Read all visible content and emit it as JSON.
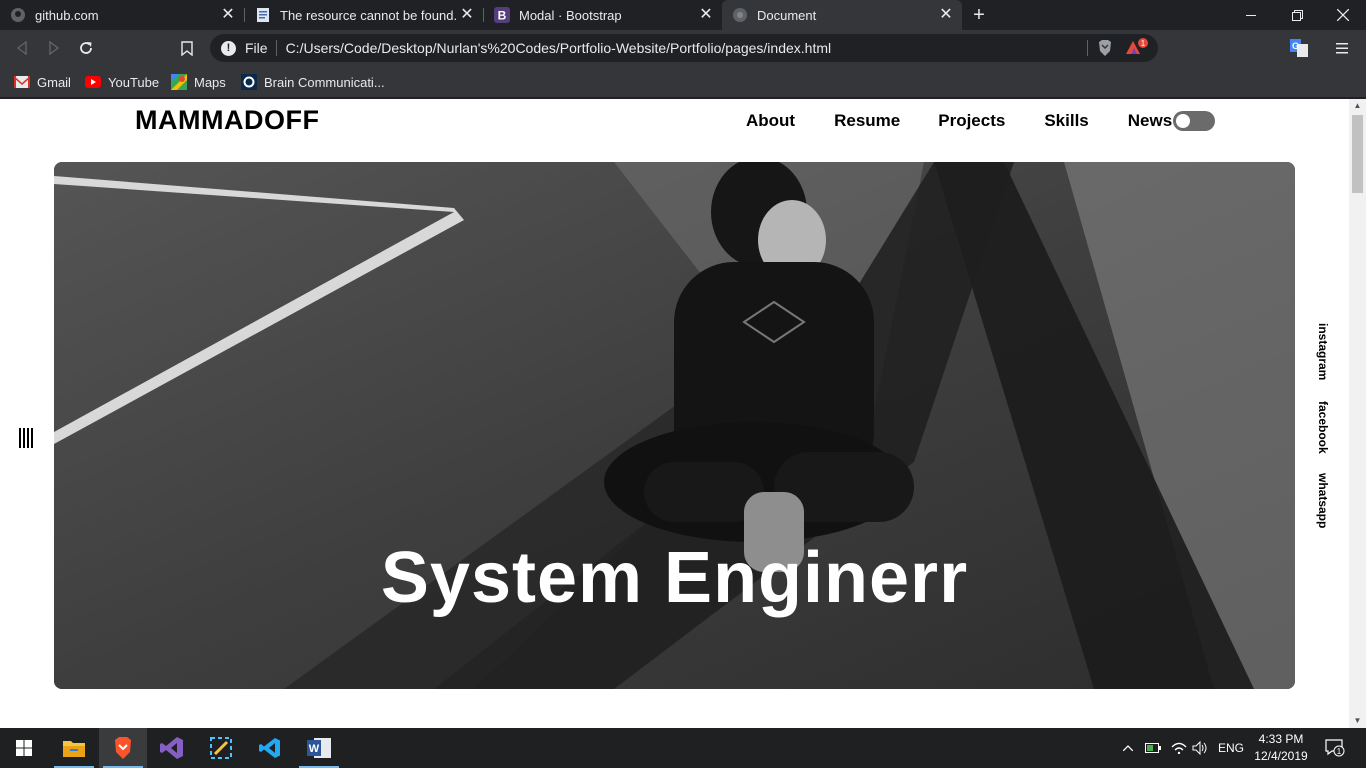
{
  "browser": {
    "tabs": [
      {
        "title": "github.com",
        "icon": "github-icon",
        "active": false
      },
      {
        "title": "The resource cannot be found.",
        "icon": "document-icon",
        "active": false
      },
      {
        "title": "Modal · Bootstrap",
        "icon": "bootstrap-icon",
        "active": false
      },
      {
        "title": "Document",
        "icon": "globe-icon",
        "active": true
      }
    ],
    "address": {
      "scheme_label": "File",
      "url": "C:/Users/Code/Desktop/Nurlan's%20Codes/Portfolio-Website/Portfolio/pages/index.html"
    },
    "rewards_badge": "1",
    "bookmarks": [
      {
        "label": "Gmail",
        "icon": "gmail-icon"
      },
      {
        "label": "YouTube",
        "icon": "youtube-icon"
      },
      {
        "label": "Maps",
        "icon": "maps-icon"
      },
      {
        "label": "Brain Communicati...",
        "icon": "brain-icon"
      }
    ]
  },
  "page": {
    "logo": "MAMMADOFF",
    "nav": [
      "About",
      "Resume",
      "Projects",
      "Skills",
      "News"
    ],
    "theme_toggle_on": false,
    "hero_title": "System Enginerr",
    "social": [
      "instagram",
      "facebook",
      "whatsapp"
    ]
  },
  "taskbar": {
    "apps": [
      "windows-start-icon",
      "file-explorer-icon",
      "brave-icon",
      "visual-studio-icon",
      "snip-tool-icon",
      "vscode-icon",
      "word-icon"
    ],
    "language": "ENG",
    "time": "4:33 PM",
    "date": "12/4/2019",
    "notifications": "1"
  },
  "colors": {
    "tab_strip": "#202124",
    "toolbar": "#35363a",
    "page_bg": "#ffffff",
    "toggle": "#6b6b6b",
    "taskbar": "#1f2022"
  }
}
